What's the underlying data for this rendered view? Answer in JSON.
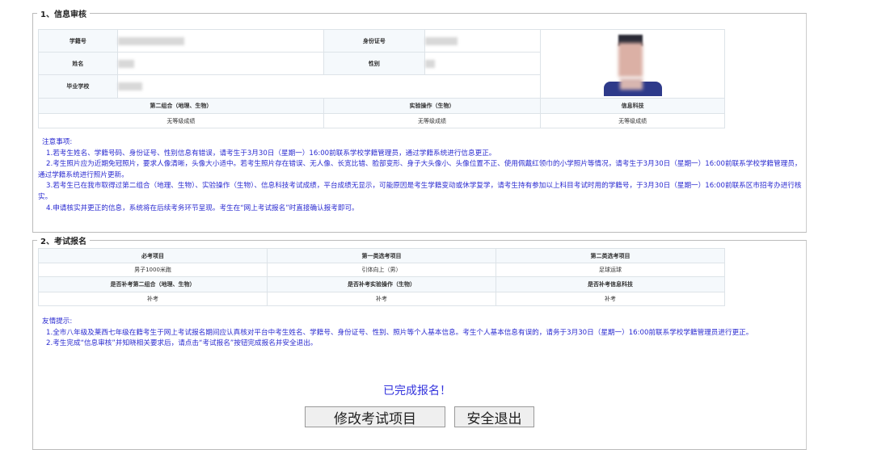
{
  "section1": {
    "legend": "1、信息审核",
    "labels": {
      "student_id": "学籍号",
      "id_card": "身份证号",
      "name": "姓名",
      "gender": "性别",
      "school": "毕业学校"
    },
    "scores": {
      "headers": [
        "第二组合（地理、生物）",
        "实验操作（生物）",
        "信息科技"
      ],
      "values": [
        "无等级成绩",
        "无等级成绩",
        "无等级成绩"
      ]
    },
    "notes": {
      "title": "注意事项:",
      "items": [
        "1.若考生姓名、学籍号码、身份证号、性别信息有错误，请考生于3月30日（星期一）16:00前联系学校学籍管理员，通过学籍系统进行信息更正。",
        "2.考生照片应为近期免冠照片，要求人像清晰，头像大小适中。若考生照片存在错误、无人像、长宽比错、脸部变形、身子大头像小、头像位置不正、使用佩戴红领巾的小学照片等情况，请考生于3月30日（星期一）16:00前联系学校学籍管理员，通过学籍系统进行照片更新。",
        "3.若考生已在我市取得过第二组合（地理、生物）、实验操作（生物）、信息科技考试成绩，平台成绩无显示，可能原因是考生学籍变动或休学复学，请考生持有参加以上科目考试时用的学籍号，于3月30日（星期一）16:00前联系区市招考办进行核实。",
        "4.申请核实并更正的信息，系统将在后续考务环节呈现。考生在“网上考试报名”时直接确认报考即可。"
      ]
    }
  },
  "section2": {
    "legend": "2、考试报名",
    "row1": {
      "headers": [
        "必考项目",
        "第一类选考项目",
        "第二类选考项目"
      ],
      "values": [
        "男子1000米跑",
        "引体向上（男）",
        "足球运球"
      ]
    },
    "row2": {
      "headers": [
        "是否补考第二组合（地理、生物）",
        "是否补考实验操作（生物）",
        "是否补考信息科技"
      ],
      "values": [
        "补考",
        "补考",
        "补考"
      ]
    },
    "tips": {
      "title": "友情提示:",
      "items": [
        "1.全市八年级及莱西七年级在籍考生于网上考试报名期间应认真核对平台中考生姓名、学籍号、身份证号、性别、照片等个人基本信息。考生个人基本信息有误的，请务于3月30日（星期一）16:00前联系学校学籍管理员进行更正。",
        "2.考生完成“信息审核”并知晓相关要求后，请点击“考试报名”按钮完成报名并安全退出。"
      ]
    }
  },
  "status": "已完成报名！",
  "buttons": {
    "modify": "修改考试项目",
    "exit": "安全退出"
  }
}
